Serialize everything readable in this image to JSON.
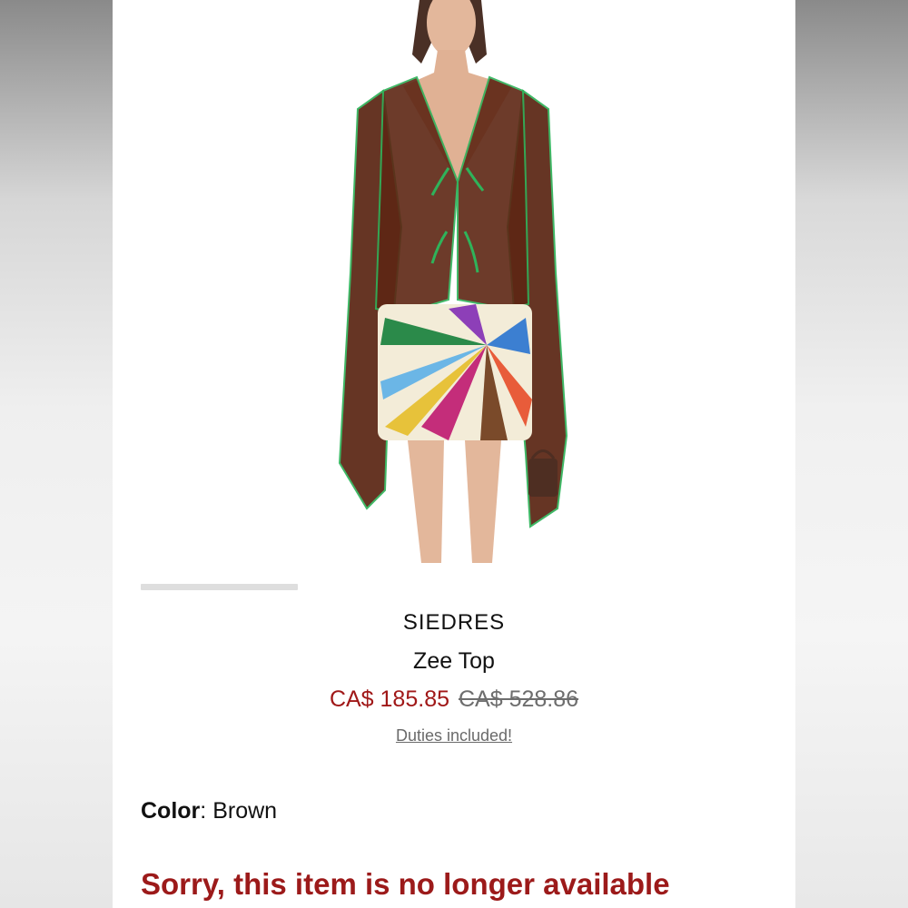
{
  "product": {
    "brand": "SIEDRES",
    "name": "Zee Top",
    "sale_price": "CA$ 185.85",
    "original_price": "CA$ 528.86",
    "duties_link": "Duties included!",
    "color_label": "Color",
    "color_separator": ": ",
    "color_value": "Brown",
    "availability_message": "Sorry, this item is no longer available"
  },
  "colors": {
    "sale_price": "#a01818",
    "availability": "#9c1a1a",
    "top_brown": "#5a2412",
    "trim_green": "#2fb35a"
  }
}
